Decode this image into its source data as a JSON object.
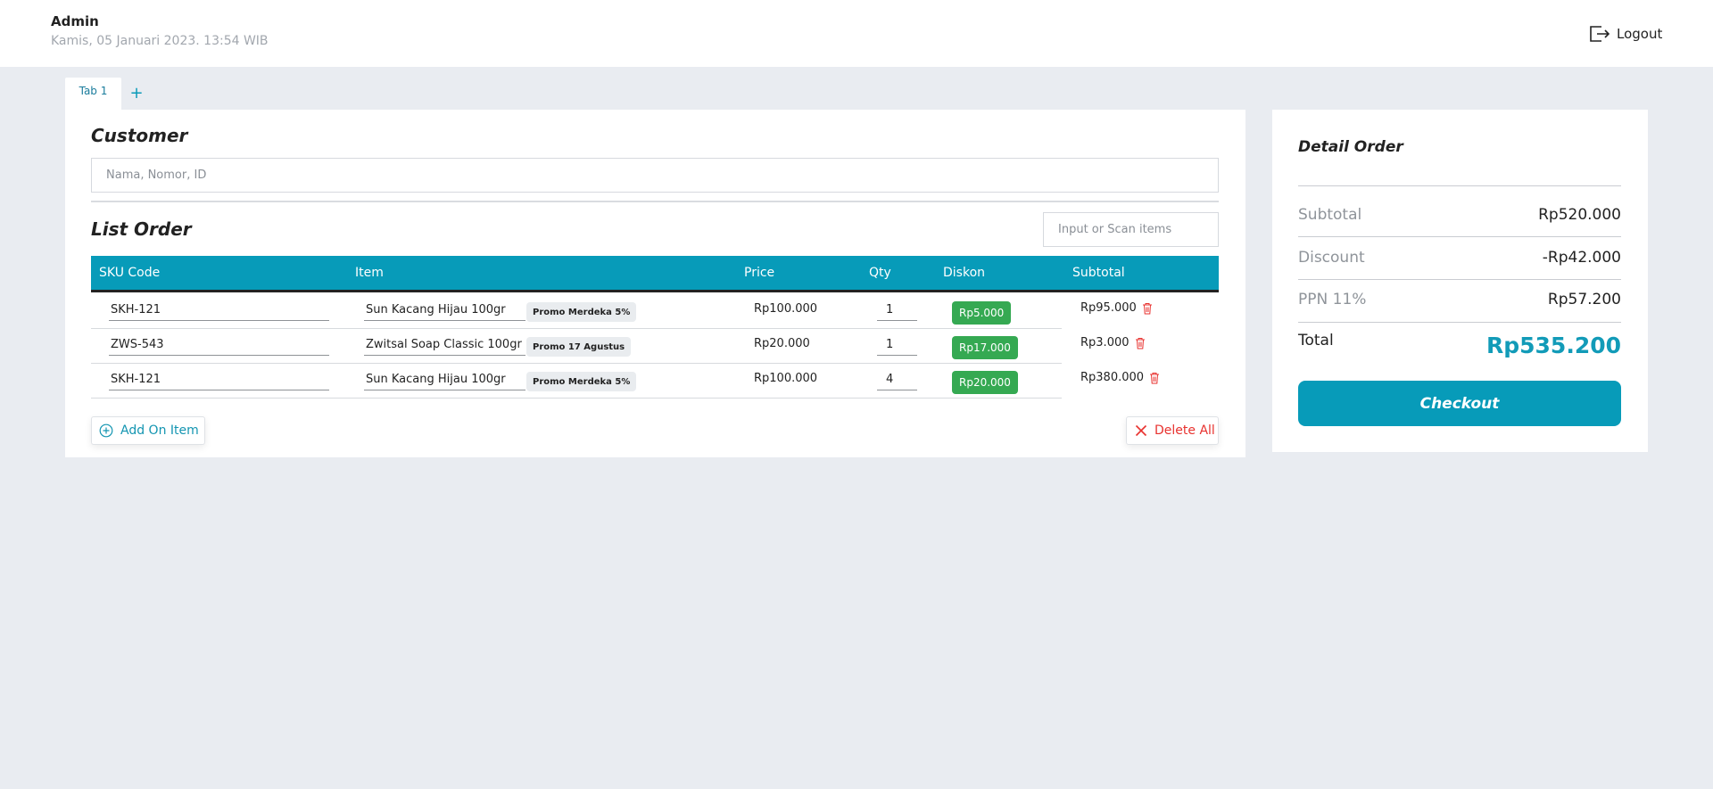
{
  "header": {
    "user_name": "Admin",
    "datetime": "Kamis, 05 Januari 2023. 13:54 WIB",
    "logout_label": "Logout",
    "logout_icon": "logout-icon"
  },
  "tabs": [
    {
      "label": "Tab 1",
      "active": true
    }
  ],
  "tab_add_label": "+",
  "customer": {
    "title": "Customer",
    "placeholder": "Nama, Nomor, ID",
    "value": ""
  },
  "list_order": {
    "title": "List Order",
    "scan_placeholder": "Input or Scan items",
    "columns": [
      "SKU Code",
      "Item",
      "Price",
      "Qty",
      "Diskon",
      "Subtotal"
    ],
    "rows": [
      {
        "sku": "SKH-121",
        "item": "Sun Kacang Hijau 100gr",
        "promo": "Promo Merdeka 5%",
        "price": "Rp100.000",
        "qty": "1",
        "diskon": "Rp5.000",
        "subtotal": "Rp95.000"
      },
      {
        "sku": "ZWS-543",
        "item": "Zwitsal Soap Classic 100gr",
        "promo": "Promo 17 Agustus",
        "price": "Rp20.000",
        "qty": "1",
        "diskon": "Rp17.000",
        "subtotal": "Rp3.000"
      },
      {
        "sku": "SKH-121",
        "item": "Sun Kacang Hijau 100gr",
        "promo": "Promo Merdeka 5%",
        "price": "Rp100.000",
        "qty": "4",
        "diskon": "Rp20.000",
        "subtotal": "Rp380.000"
      }
    ],
    "add_label": "Add On Item",
    "delete_all_label": "Delete All"
  },
  "detail_order": {
    "title": "Detail Order",
    "subtotal_label": "Subtotal",
    "subtotal_value": "Rp520.000",
    "discount_label": "Discount",
    "discount_value": "-Rp42.000",
    "ppn_label": "PPN 11%",
    "ppn_value": "Rp57.200",
    "total_label": "Total",
    "total_value": "Rp535.200",
    "checkout_label": "Checkout"
  },
  "colors": {
    "accent": "#079bb9",
    "discount_green": "#35a952",
    "danger": "#e8322f",
    "background": "#e9ecf1"
  }
}
